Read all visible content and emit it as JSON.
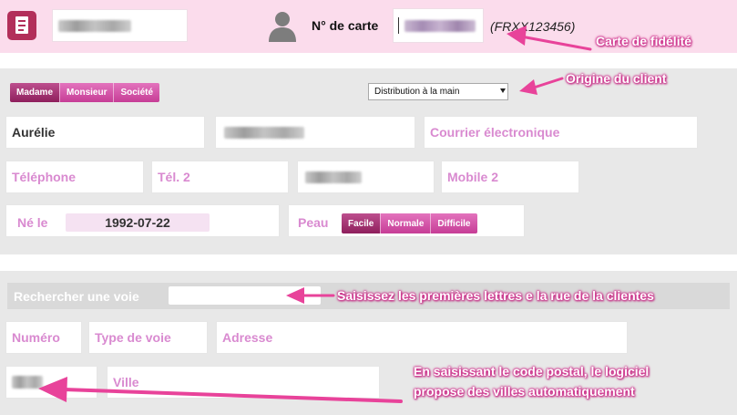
{
  "header": {
    "card_label": "N° de carte",
    "card_hint": "(FRXX123456)"
  },
  "civility": {
    "options": [
      "Madame",
      "Monsieur",
      "Société"
    ]
  },
  "origin": {
    "selected": "Distribution à la main"
  },
  "form": {
    "first_name": "Aurélie",
    "email_placeholder": "Courrier électronique",
    "phone_placeholder": "Téléphone",
    "phone2_placeholder": "Tél. 2",
    "mobile2_placeholder": "Mobile 2",
    "dob_label": "Né le",
    "dob_value": "1992-07-22",
    "skin_label": "Peau",
    "skin_options": [
      "Facile",
      "Normale",
      "Difficile"
    ]
  },
  "address": {
    "search_label": "Rechercher une voie",
    "number_placeholder": "Numéro",
    "type_placeholder": "Type de voie",
    "address_placeholder": "Adresse",
    "city_placeholder": "Ville"
  },
  "annotations": {
    "loyalty_card": "Carte de fidélité",
    "client_origin": "Origine du client",
    "street_search": "Saisissez les premières lettres e la rue de la clientes",
    "postal_line1": "En saisissant le code postal, le logiciel",
    "postal_line2": "propose des villes automatiquement"
  },
  "colors": {
    "header_bg": "#fbdcec",
    "accent_pink": "#d4308f",
    "brand_icon": "#b22f5a",
    "placeholder_pink": "#d98ad0"
  }
}
